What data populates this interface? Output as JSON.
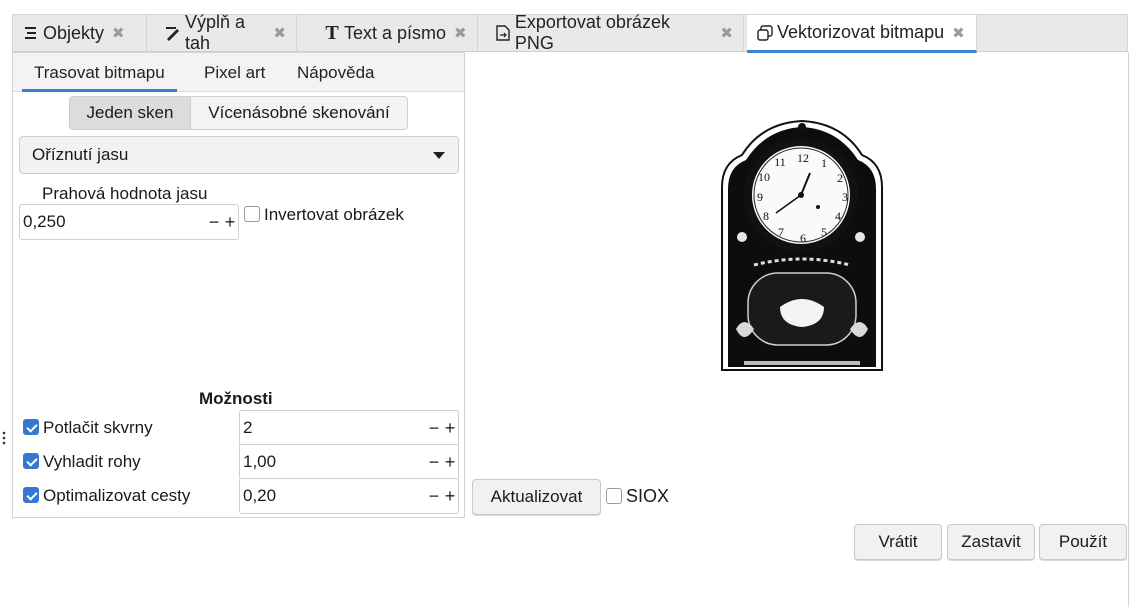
{
  "dock_tabs": [
    {
      "label": "Objekty",
      "icon": "objects-icon"
    },
    {
      "label": "Výplň a tah",
      "icon": "fill-stroke-icon"
    },
    {
      "label": "Text a písmo",
      "icon": "text-font-icon"
    },
    {
      "label": "Exportovat obrázek PNG",
      "icon": "export-icon"
    },
    {
      "label": "Vektorizovat bitmapu",
      "icon": "trace-bitmap-icon",
      "active": true
    }
  ],
  "sub_tabs": [
    "Trasovat bitmapu",
    "Pixel art",
    "Nápověda"
  ],
  "scan_modes": [
    "Jeden sken",
    "Vícenásobné skenování"
  ],
  "mode_select": {
    "value": "Oříznutí jasu"
  },
  "threshold": {
    "label": "Prahová hodnota jasu",
    "value": "0,250"
  },
  "invert_label": "Invertovat obrázek",
  "options": {
    "heading": "Možnosti",
    "items": [
      {
        "label": "Potlačit skvrny",
        "value": "2",
        "checked": true
      },
      {
        "label": "Vyhladit rohy",
        "value": "1,00",
        "checked": true
      },
      {
        "label": "Optimalizovat cesty",
        "value": "0,20",
        "checked": true
      }
    ]
  },
  "update_button": "Aktualizovat",
  "siox_label": "SIOX",
  "actions": {
    "revert": "Vrátit",
    "stop": "Zastavit",
    "apply": "Použít"
  },
  "spin_minus": "−",
  "spin_plus": "+",
  "colors": {
    "accent": "#3b82d6",
    "checkbox": "#3478d4"
  }
}
